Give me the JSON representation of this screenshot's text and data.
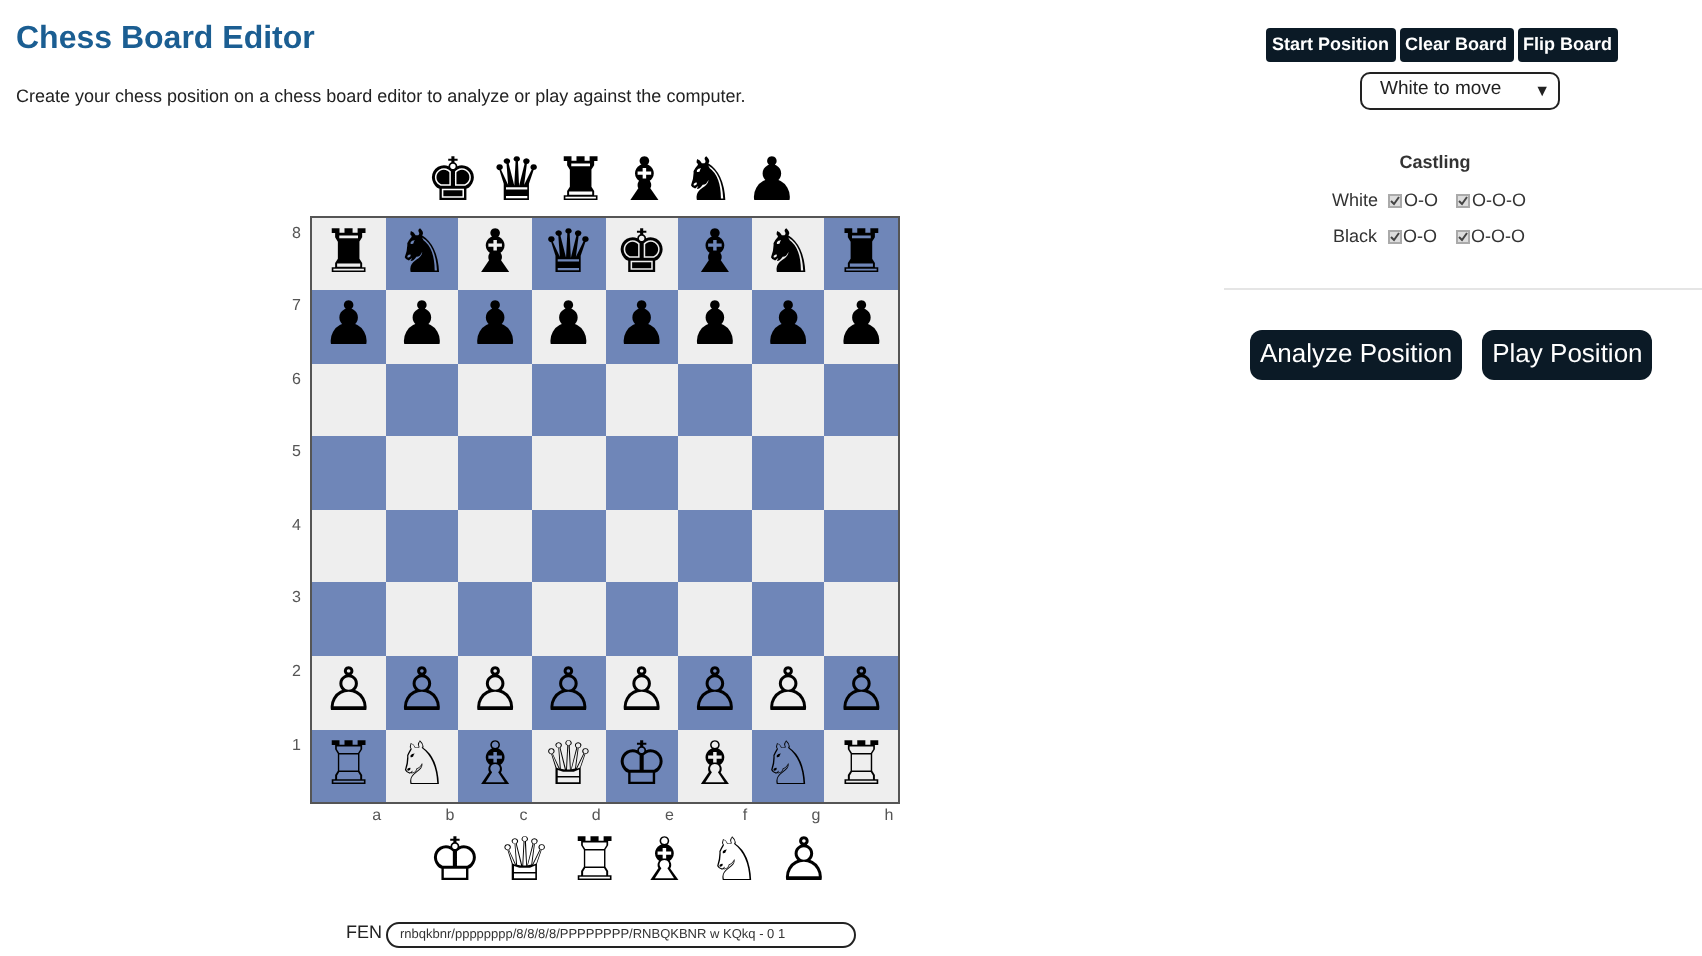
{
  "title": "Chess Board Editor",
  "description": "Create your chess position on a chess board editor to analyze or play against the computer.",
  "black_palette": [
    "♚",
    "♛",
    "♜",
    "♝",
    "♞",
    "♟"
  ],
  "board": {
    "ranks": [
      {
        "label": "8",
        "pieces": [
          "♜",
          "♞",
          "♝",
          "♛",
          "♚",
          "♝",
          "♞",
          "♜"
        ]
      },
      {
        "label": "7",
        "pieces": [
          "♟",
          "♟",
          "♟",
          "♟",
          "♟",
          "♟",
          "♟",
          "♟"
        ]
      },
      {
        "label": "6"
      },
      {
        "label": "5"
      },
      {
        "label": "4"
      },
      {
        "label": "3"
      },
      {
        "label": "2",
        "pieces": [
          "♙",
          "♙",
          "♙",
          "♙",
          "♙",
          "♙",
          "♙",
          "♙"
        ]
      },
      {
        "label": "1",
        "pieces": [
          "♖",
          "♘",
          "♗",
          "♕",
          "♔",
          "♗",
          "♘",
          "♖"
        ]
      }
    ],
    "files": [
      "a",
      "b",
      "c",
      "d",
      "e",
      "f",
      "g",
      "h"
    ]
  },
  "white_palette": [
    "♔",
    "♕",
    "♖",
    "♗",
    "♘",
    "♙"
  ],
  "fen": {
    "label": "FEN",
    "value": "rnbqkbnr/pppppppp/8/8/8/8/PPPPPPPP/RNBQKBNR w KQkq - 0 1"
  },
  "toolbar": [
    "Start Position",
    "Clear Board",
    "Flip Board"
  ],
  "side_select": {
    "value": "White to move",
    "arrow": "▼"
  },
  "castling": {
    "title": "Castling",
    "rows": [
      {
        "side": "White",
        "options": [
          {
            "label": "O-O",
            "checked": true
          },
          {
            "label": "O-O-O",
            "checked": true
          }
        ]
      },
      {
        "side": "Black",
        "options": [
          {
            "label": "O-O",
            "checked": true
          },
          {
            "label": "O-O-O",
            "checked": true
          }
        ]
      }
    ]
  },
  "actions": [
    "Analyze Position",
    "Play Position"
  ]
}
